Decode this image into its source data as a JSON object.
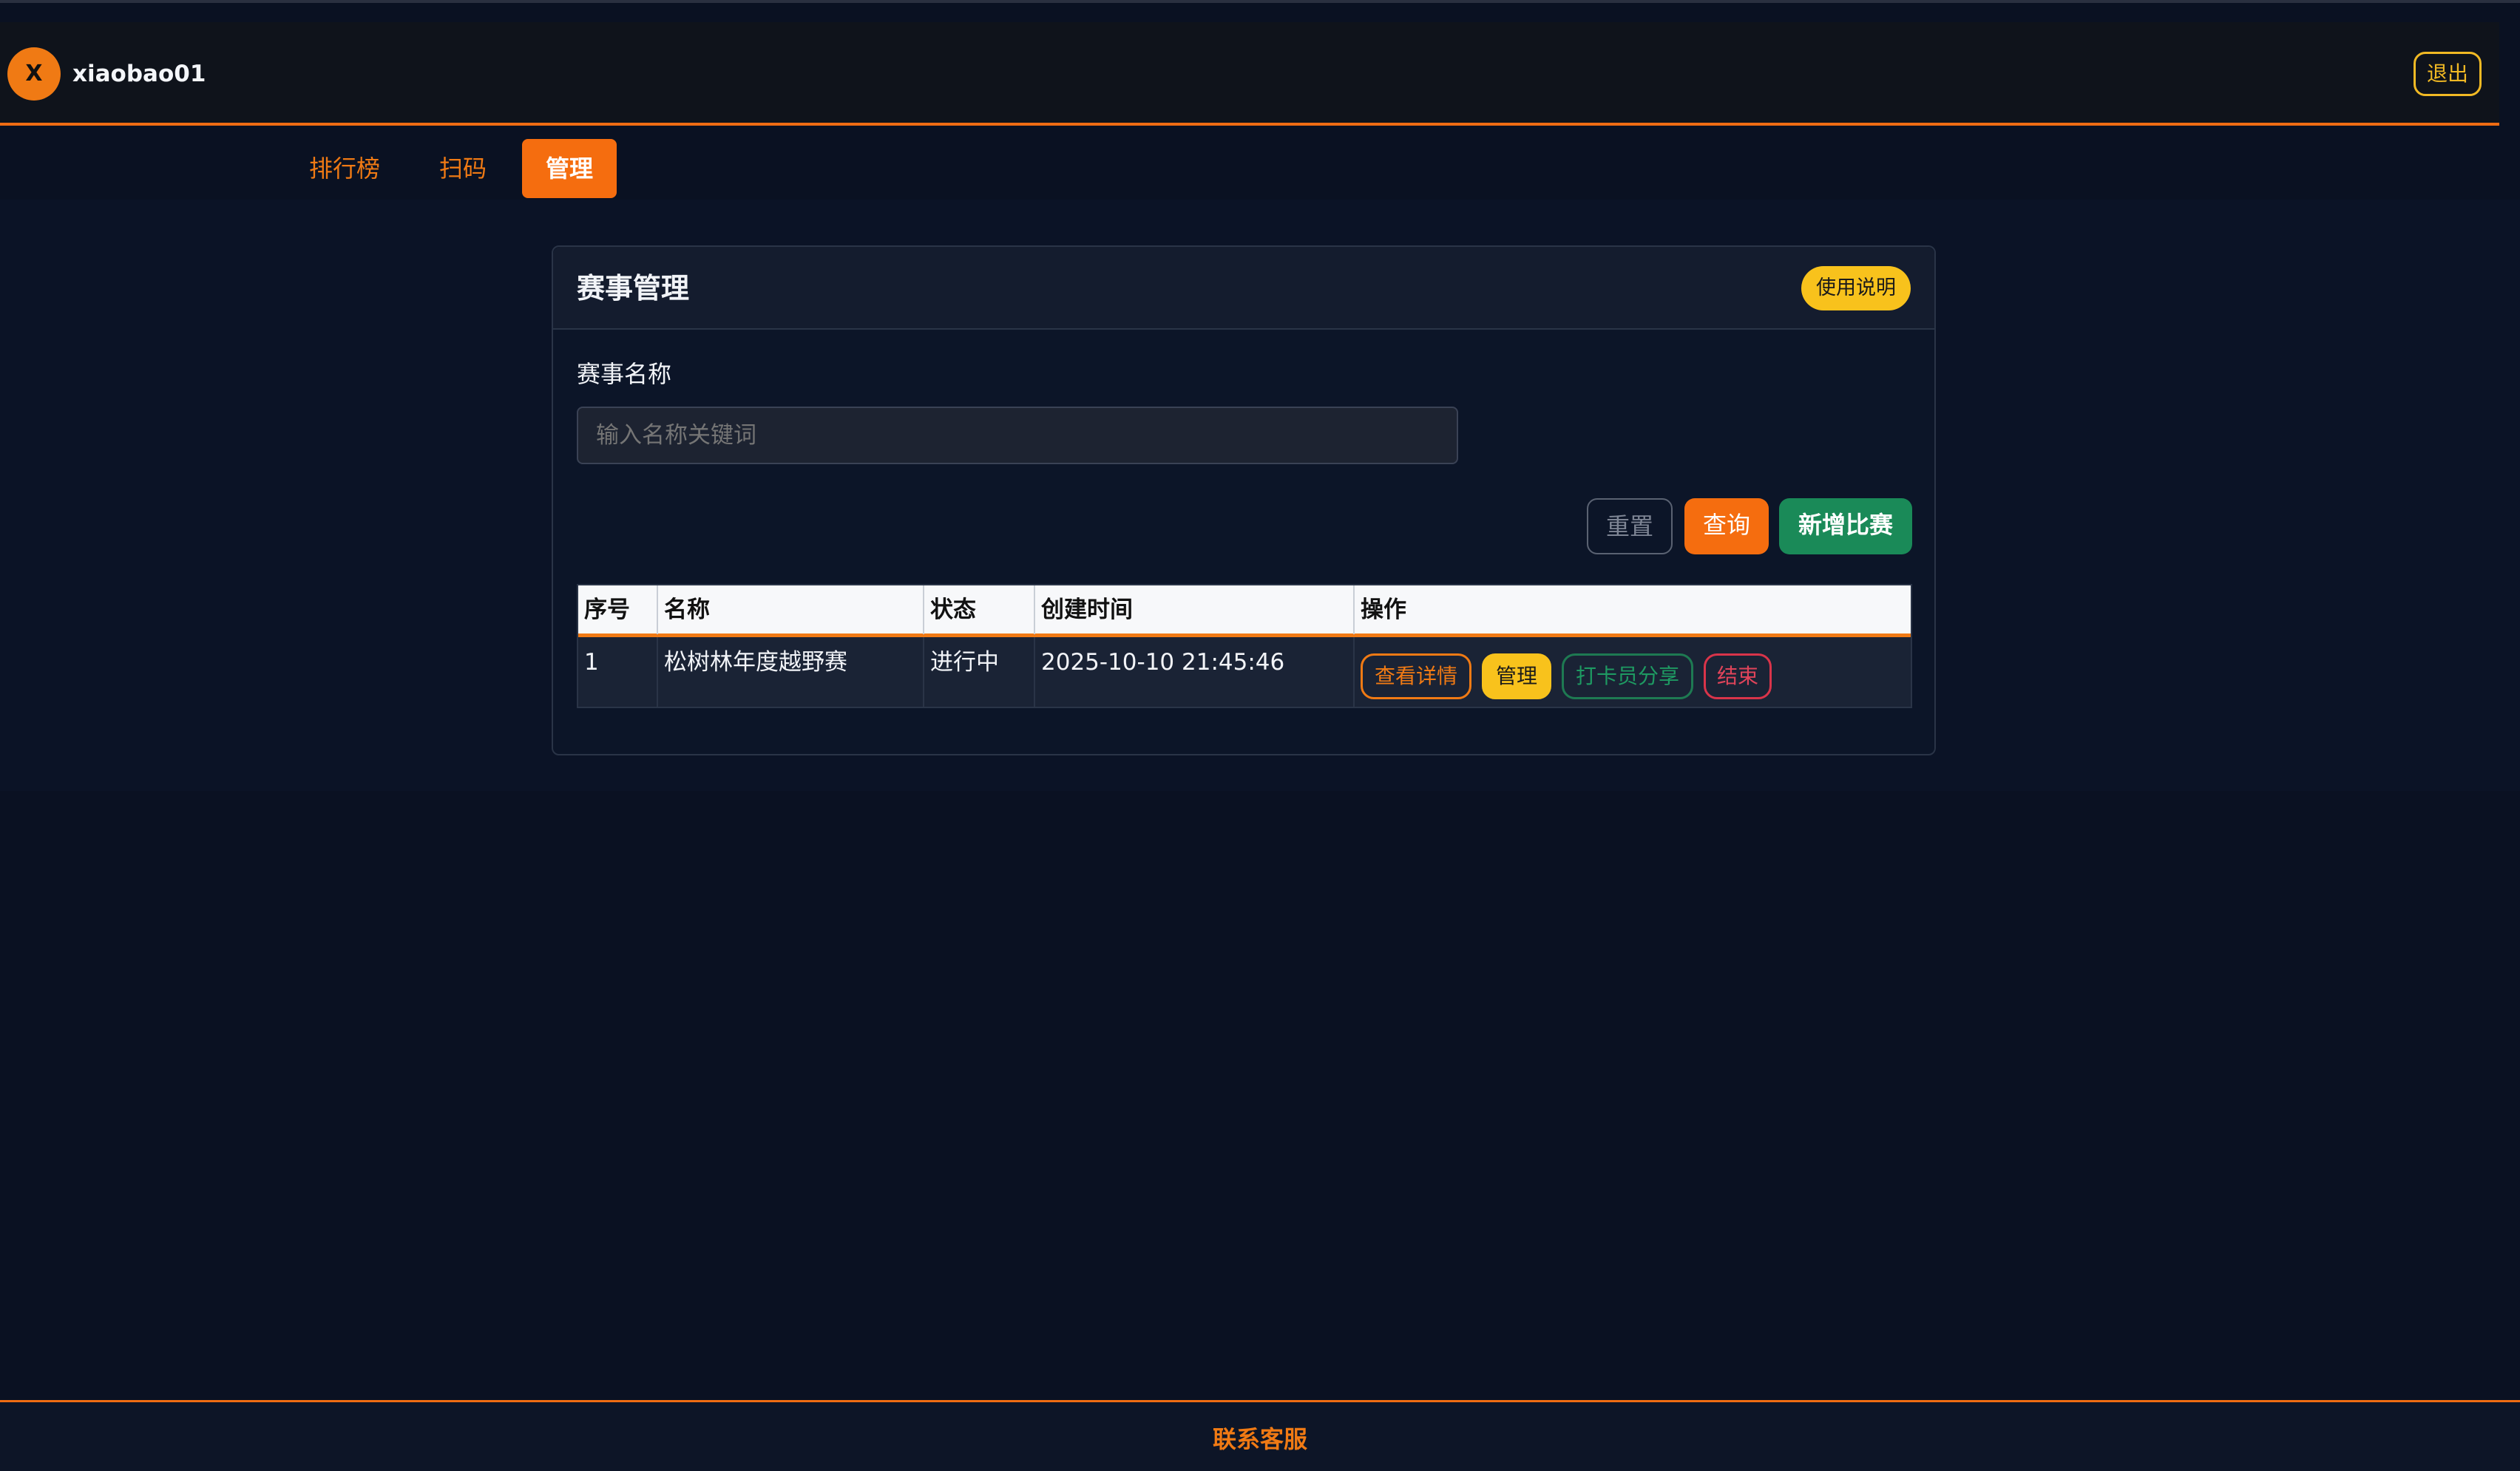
{
  "header": {
    "avatar_letter": "X",
    "username": "xiaobao01",
    "logout_label": "退出"
  },
  "nav": {
    "tabs": [
      {
        "label": "排行榜",
        "active": false
      },
      {
        "label": "扫码",
        "active": false
      },
      {
        "label": "管理",
        "active": true
      }
    ]
  },
  "card": {
    "title": "赛事管理",
    "help_label": "使用说明",
    "filter": {
      "label": "赛事名称",
      "value": "",
      "placeholder": "输入名称关键词"
    },
    "buttons": {
      "reset": "重置",
      "query": "查询",
      "add": "新增比赛"
    },
    "table": {
      "headers": [
        "序号",
        "名称",
        "状态",
        "创建时间",
        "操作"
      ],
      "rows": [
        {
          "index": "1",
          "name": "松树林年度越野赛",
          "status": "进行中",
          "created": "2025-10-10 21:45:46",
          "actions": {
            "detail": "查看详情",
            "manage": "管理",
            "share": "打卡员分享",
            "end": "结束"
          }
        }
      ]
    }
  },
  "footer": {
    "contact_label": "联系客服"
  },
  "colors": {
    "accent": "#f07a14",
    "background": "#0a1122",
    "warning": "#f8c21c",
    "success": "#1a8a58",
    "danger": "#d9344a"
  }
}
